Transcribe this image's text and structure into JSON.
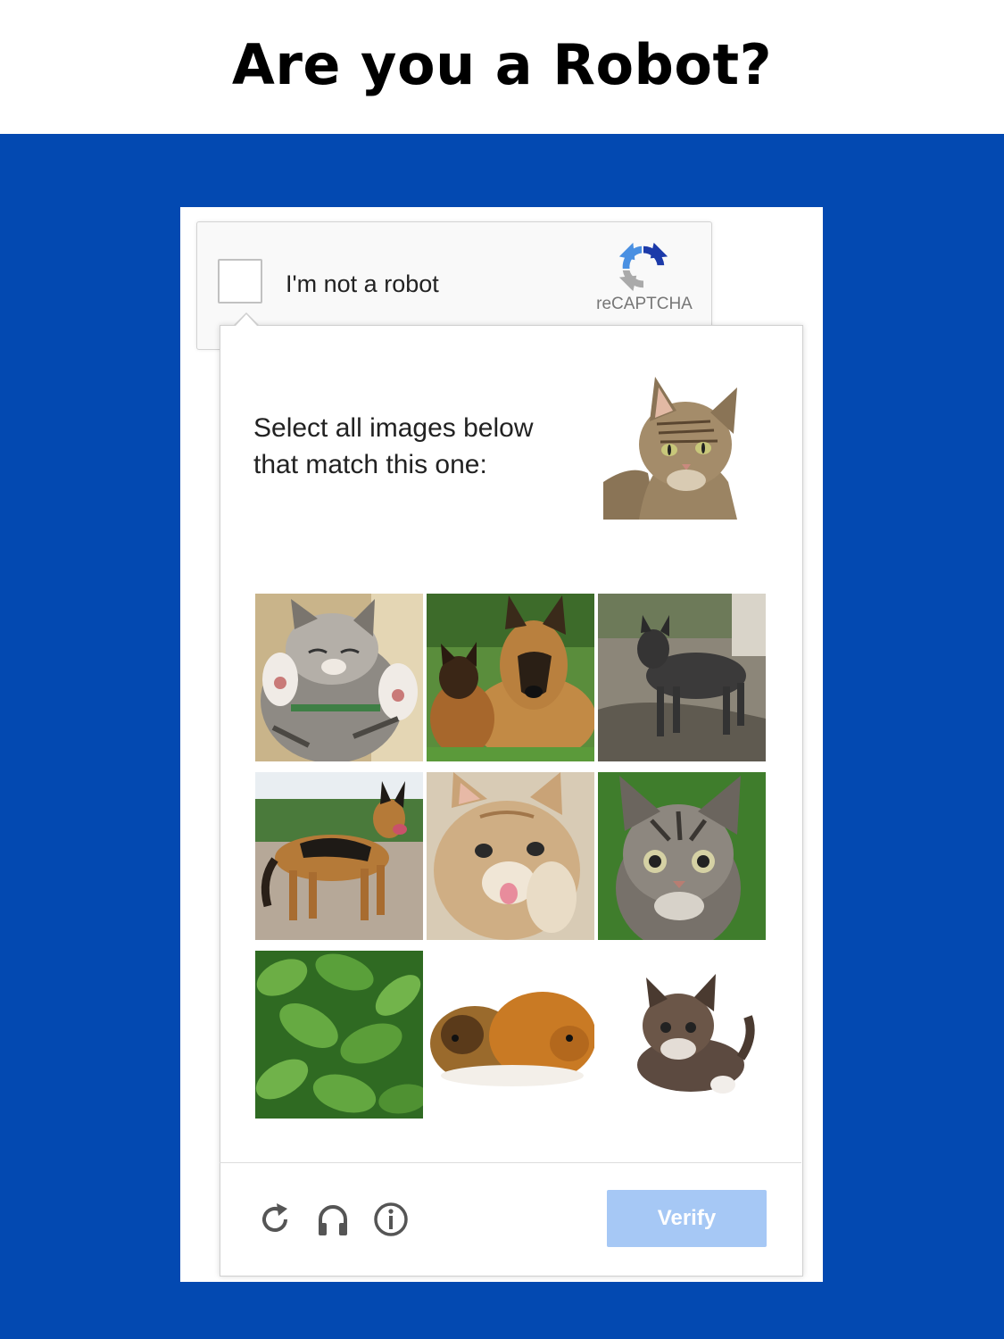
{
  "page": {
    "title": "Are you a Robot?"
  },
  "anchor": {
    "checkbox_label": "I'm not a robot",
    "brand": "reCAPTCHA",
    "logo_icon": "recaptcha-logo-icon"
  },
  "challenge": {
    "instruction_line1": "Select all images below",
    "instruction_line2": "that match this one:",
    "reference_image": "tabby-cat",
    "tiles": [
      "kitten-paws-up",
      "german-shepherd-with-puppy",
      "dark-dog-on-dirt",
      "german-shepherd-standing",
      "kitten-licking-paw",
      "tabby-kitten-on-grass",
      "green-leaves",
      "guinea-pigs",
      "small-tortoiseshell-kitten"
    ]
  },
  "footer": {
    "reload_icon": "reload-icon",
    "audio_icon": "headphones-icon",
    "info_icon": "info-icon",
    "verify_label": "Verify"
  },
  "colors": {
    "band_blue": "#0349b1",
    "verify_disabled": "#a6c8f5"
  }
}
